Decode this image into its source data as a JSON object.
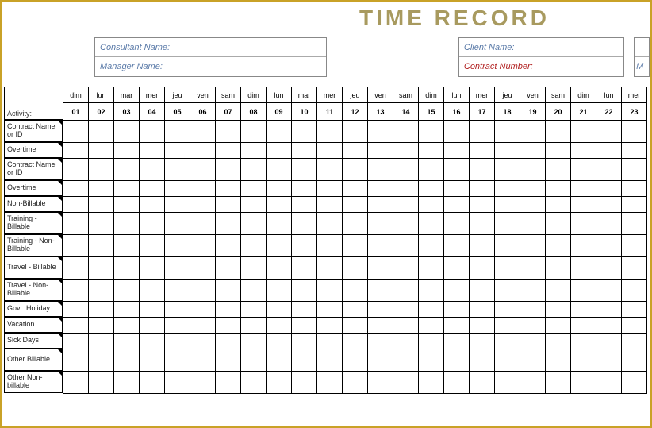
{
  "title": "TIME  RECORD",
  "header": {
    "left": {
      "consultant_label": "Consultant Name:",
      "manager_label": "Manager Name:"
    },
    "right": {
      "client_label": "Client Name:",
      "contract_label": "Contract Number:"
    },
    "extra": {
      "m_label": "M"
    }
  },
  "activity_header": "Activity:",
  "days": [
    "dim",
    "lun",
    "mar",
    "mer",
    "jeu",
    "ven",
    "sam",
    "dim",
    "lun",
    "mar",
    "mer",
    "jeu",
    "ven",
    "sam",
    "dim",
    "lun",
    "mer",
    "jeu",
    "ven",
    "sam",
    "dim",
    "lun",
    "mer"
  ],
  "nums": [
    "01",
    "02",
    "03",
    "04",
    "05",
    "06",
    "07",
    "08",
    "09",
    "10",
    "11",
    "12",
    "13",
    "14",
    "15",
    "16",
    "17",
    "18",
    "19",
    "20",
    "21",
    "22",
    "23"
  ],
  "activities": [
    {
      "label": "Contract Name or ID",
      "h": "tall"
    },
    {
      "label": "Overtime",
      "h": "short"
    },
    {
      "label": "Contract Name or ID",
      "h": "tall"
    },
    {
      "label": "Overtime",
      "h": "short"
    },
    {
      "label": "Non-Billable",
      "h": "short"
    },
    {
      "label": "Training - Billable",
      "h": "tall"
    },
    {
      "label": "Training - Non-Billable",
      "h": "tall"
    },
    {
      "label": "Travel - Billable",
      "h": "tall"
    },
    {
      "label": "Travel - Non-Billable",
      "h": "tall"
    },
    {
      "label": "Govt. Holiday",
      "h": "short"
    },
    {
      "label": "Vacation",
      "h": "short"
    },
    {
      "label": "Sick Days",
      "h": "short"
    },
    {
      "label": "Other Billable",
      "h": "tall"
    },
    {
      "label": "Other Non-billable",
      "h": "tall"
    }
  ]
}
